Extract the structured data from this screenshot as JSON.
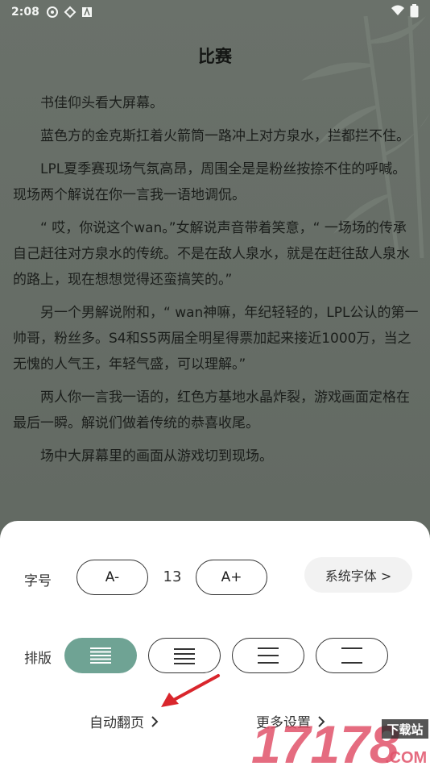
{
  "status": {
    "time": "2:08"
  },
  "chapter": {
    "title": "比赛",
    "paragraphs": [
      "书佳仰头看大屏幕。",
      "蓝色方的金克斯扛着火箭筒一路冲上对方泉水，拦都拦不住。",
      "LPL夏季赛现场气氛高昂，周围全是是粉丝按捺不住的呼喊。现场两个解说在你一言我一语地调侃。",
      "“ 哎，你说这个wan。”女解说声音带着笑意，“ 一场场的传承自己赶往对方泉水的传统。不是在敌人泉水，就是在赶往敌人泉水的路上，现在想想觉得还蛮搞笑的。”",
      "另一个男解说附和，“ wan神嘛，年纪轻轻的，LPL公认的第一帅哥，粉丝多。S4和S5两届全明星得票加起来接近1000万，当之无愧的人气王，年轻气盛，可以理解。”",
      "两人你一言我一语的，红色方基地水晶炸裂，游戏画面定格在最后一瞬。解说们做着传统的恭喜收尾。",
      "场中大屏幕里的画面从游戏切到现场。"
    ]
  },
  "settings": {
    "font_size_label": "字号",
    "decrease_label": "A-",
    "font_size_value": "13",
    "increase_label": "A+",
    "system_font_label": "系统字体 >",
    "layout_label": "排版",
    "auto_page_label": "自动翻页",
    "more_settings_label": "更多设置"
  },
  "watermark": {
    "brand_text": "17178",
    "badge_text": "下载站",
    "suffix_text": ".COM"
  },
  "colors": {
    "accent": "#6fa394",
    "annotation_arrow": "#d9262c",
    "watermark": "#e1526a"
  }
}
